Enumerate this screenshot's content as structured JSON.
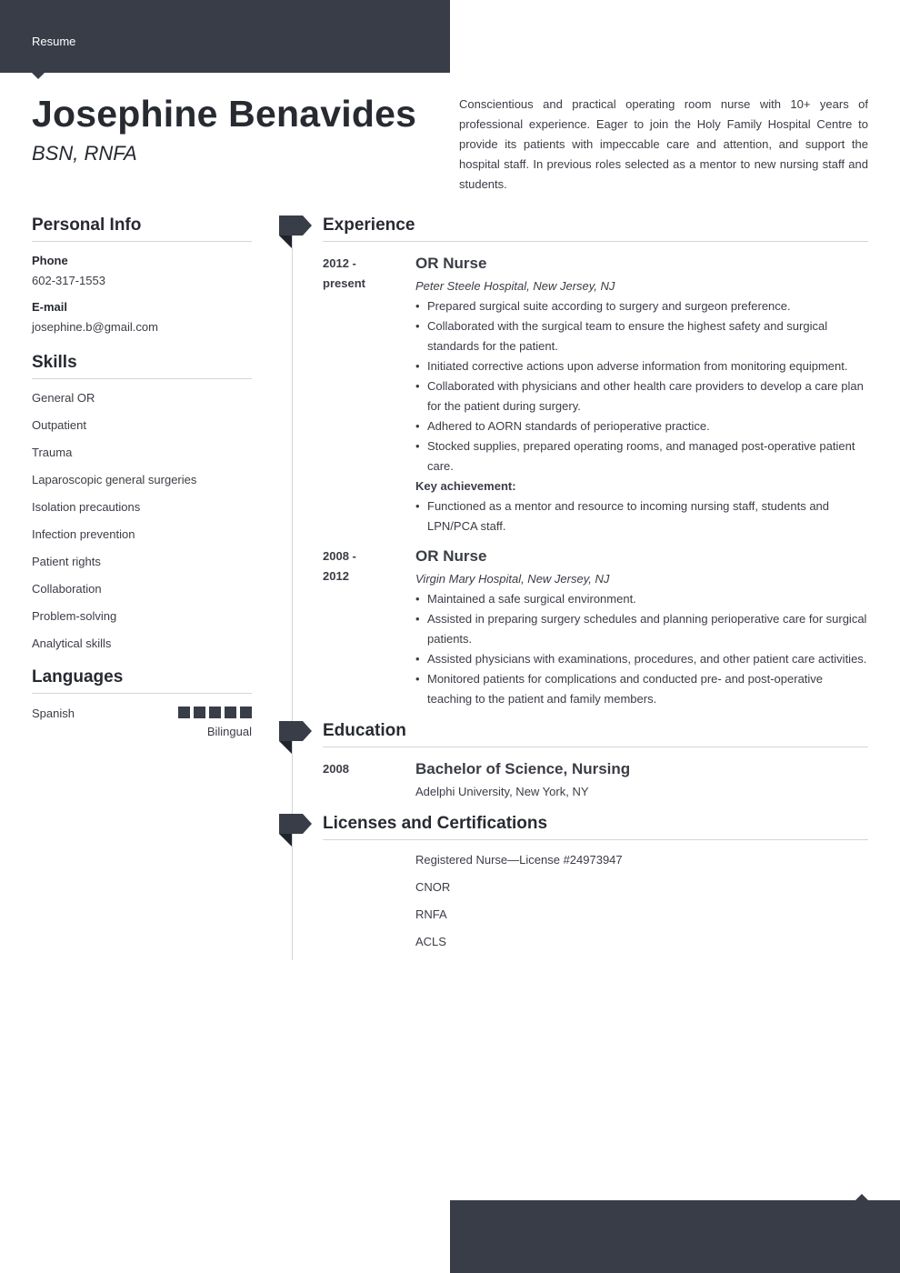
{
  "header": {
    "label": "Resume",
    "name": "Josephine Benavides",
    "credentials": "BSN, RNFA",
    "summary": "Conscientious and practical operating room nurse with 10+ years of professional experience. Eager to join the Holy Family Hospital Centre to provide its patients with impeccable care and attention, and support the hospital staff. In previous roles selected as a mentor to new nursing staff and students."
  },
  "personal_info": {
    "title": "Personal Info",
    "phone_label": "Phone",
    "phone": "602-317-1553",
    "email_label": "E-mail",
    "email": "josephine.b@gmail.com"
  },
  "skills": {
    "title": "Skills",
    "items": [
      "General OR",
      "Outpatient",
      "Trauma",
      "Laparoscopic general surgeries",
      "Isolation precautions",
      "Infection prevention",
      "Patient rights",
      "Collaboration",
      "Problem-solving",
      "Analytical skills"
    ]
  },
  "languages": {
    "title": "Languages",
    "items": [
      {
        "name": "Spanish",
        "level": "Bilingual",
        "rating": 5,
        "max": 5
      }
    ]
  },
  "experience": {
    "title": "Experience",
    "jobs": [
      {
        "dates_start": "2012 -",
        "dates_end": "present",
        "title": "OR Nurse",
        "employer": "Peter Steele Hospital, New Jersey, NJ",
        "bullets": [
          "Prepared surgical suite according to surgery and surgeon preference.",
          "Collaborated with the surgical team to ensure the highest safety and surgical standards for the patient.",
          "Initiated corrective actions upon adverse information from monitoring equipment.",
          "Collaborated with physicians and other health care providers to develop a care plan for the patient during surgery.",
          "Adhered to AORN standards of perioperative practice.",
          "Stocked supplies, prepared operating rooms, and managed post-operative patient care."
        ],
        "key_achievement_label": "Key achievement:",
        "key_achievements": [
          "Functioned as a mentor and resource to incoming nursing staff, students and LPN/PCA staff."
        ]
      },
      {
        "dates_start": "2008 -",
        "dates_end": "2012",
        "title": "OR Nurse",
        "employer": "Virgin Mary Hospital, New Jersey, NJ",
        "bullets": [
          "Maintained a safe surgical environment.",
          "Assisted in preparing surgery schedules and planning perioperative care for surgical patients.",
          "Assisted physicians with examinations, procedures, and other patient care activities.",
          "Monitored patients for complications and conducted pre- and post-operative teaching to the patient and family members."
        ]
      }
    ]
  },
  "education": {
    "title": "Education",
    "items": [
      {
        "year": "2008",
        "degree": "Bachelor of Science, Nursing",
        "school": "Adelphi University, New York, NY"
      }
    ]
  },
  "certifications": {
    "title": "Licenses and Certifications",
    "items": [
      "Registered Nurse—License #24973947",
      "CNOR",
      "RNFA",
      "ACLS"
    ]
  },
  "colors": {
    "accent": "#383d48",
    "heading": "#272a31",
    "text": "#3a3d44",
    "rule": "#d4d5d8"
  }
}
